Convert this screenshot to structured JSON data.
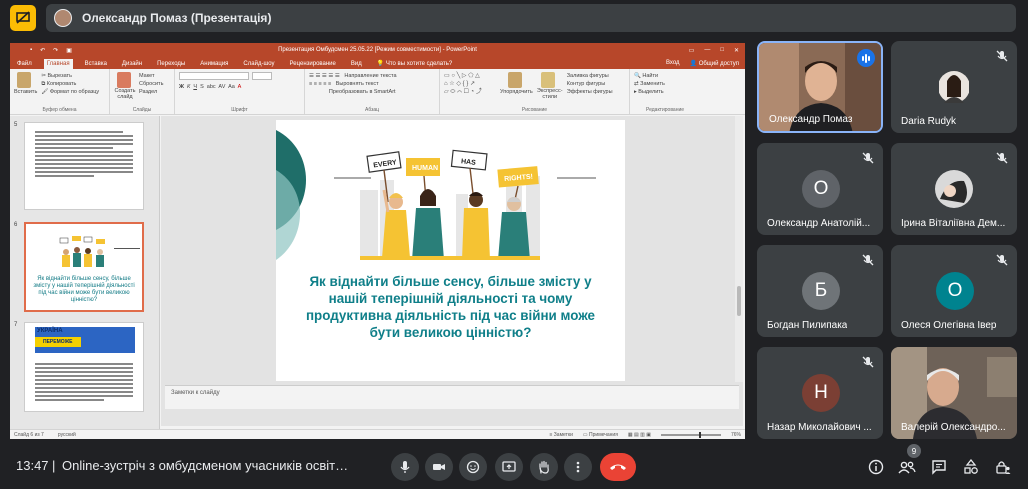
{
  "topbar": {
    "presenter_label": "Олександр Помаз (Презентація)"
  },
  "powerpoint": {
    "window_title": "Презентация Омбудсмен 25.05.22  [Режим совместимости] - PowerPoint",
    "tabs": [
      "Файл",
      "Главная",
      "Вставка",
      "Дизайн",
      "Переходы",
      "Анимация",
      "Слайд-шоу",
      "Рецензирование",
      "Вид"
    ],
    "active_tab": "Главная",
    "tell_me": "Что вы хотите сделать?",
    "sign_in": "Вход",
    "share": "Общий доступ",
    "groups": {
      "clipboard": {
        "name": "Буфер обмена",
        "paste": "Вставить",
        "cut": "Вырезать",
        "copy": "Копировать",
        "format": "Формат по образцу"
      },
      "slides": {
        "name": "Слайды",
        "new_slide": "Создать слайд",
        "layout": "Макет",
        "reset": "Сбросить",
        "section": "Раздел"
      },
      "font": {
        "name": "Шрифт"
      },
      "paragraph": {
        "name": "Абзац",
        "text_direction": "Направление текста",
        "align_text": "Выровнять текст",
        "smartart": "Преобразовать в SmartArt"
      },
      "drawing": {
        "name": "Рисование",
        "arrange": "Упорядочить",
        "quick_styles": "Экспресс-стили",
        "fill": "Заливка фигуры",
        "outline": "Контур фигуры",
        "effects": "Эффекты фигуры"
      },
      "editing": {
        "name": "Редактирование",
        "find": "Найти",
        "replace": "Заменить",
        "select": "Выделить"
      }
    },
    "thumbnails": [
      {
        "num": "5"
      },
      {
        "num": "6",
        "title": "Як віднайти більше сенсу, більше змісту у нашій теперішній діяльності під час війни може бути великою цінністю?"
      },
      {
        "num": "7",
        "banner_top": "УКРАЇНА",
        "banner_bottom": "ПЕРЕМОЖЕ"
      }
    ],
    "slide": {
      "title": "Як віднайти більше сенсу, більше змісту у нашій теперішній діяльності та чому продуктивна діяльність під час війни може бути великою цінністю?",
      "sign_words": [
        "EVERY",
        "HUMAN",
        "HAS",
        "RIGHTS!"
      ]
    },
    "notes_placeholder": "Заметки к слайду",
    "status": {
      "slide_count": "Слайд 6 из 7",
      "language": "русский",
      "notes_btn": "Заметки",
      "comments_btn": "Примечания",
      "zoom": "76%"
    }
  },
  "participants": [
    {
      "name": "Олександр Помаз",
      "avatar": "",
      "speaking": true
    },
    {
      "name": "Daria Rudyk",
      "avatar": "",
      "muted": true
    },
    {
      "name": "Олександр Анатолій...",
      "avatar": "О",
      "color": "#5f6368",
      "muted": true
    },
    {
      "name": "Ірина Віталіївна Дем...",
      "avatar": "",
      "muted": true
    },
    {
      "name": "Богдан Пилипака",
      "avatar": "Б",
      "color": "#6f7478",
      "muted": true
    },
    {
      "name": "Олеся Олегівна Івер",
      "avatar": "О",
      "color": "#00838f",
      "muted": true
    },
    {
      "name": "Назар Миколайович ...",
      "avatar": "Н",
      "color": "#7b3f34",
      "muted": true
    },
    {
      "name": "Валерій Олександро...",
      "avatar": "",
      "muted": false
    }
  ],
  "bottombar": {
    "time": "13:47",
    "meeting_title": "Online-зустріч з омбудсменом учасників освітнь...",
    "participants_count": "9"
  },
  "colors": {
    "meet_bg": "#202124",
    "tile_bg": "#3c4043",
    "end_call": "#ea4335",
    "ppt_ribbon": "#b7472a",
    "slide_title": "#0f7f89",
    "slide_accent": "#2a7f79"
  }
}
